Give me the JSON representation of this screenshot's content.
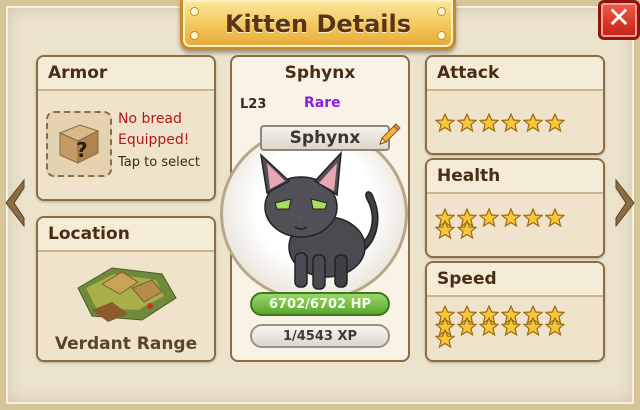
{
  "window": {
    "title": "Kitten Details",
    "close_label": "✕"
  },
  "armor": {
    "header": "Armor",
    "status_line1": "No bread",
    "status_line2": "Equipped!",
    "hint": "Tap to select",
    "slot_icon": "?"
  },
  "location": {
    "header": "Location",
    "name": "Verdant Range"
  },
  "kitten": {
    "name": "Sphynx",
    "level": "L23",
    "rarity": "Rare",
    "plate_name": "Sphynx",
    "hp": "6702/6702 HP",
    "xp": "1/4543 XP"
  },
  "stats": [
    {
      "header": "Attack",
      "stars": 6.0
    },
    {
      "header": "Health",
      "stars": 8.0
    },
    {
      "header": "Speed",
      "stars": 13.0
    }
  ],
  "colors": {
    "accent_gold": "#f3c75a",
    "close_red": "#c51f16",
    "rarity_purple": "#8b1fe0",
    "warning_red": "#b4161b",
    "hp_green": "#5aa52f"
  },
  "icons": {
    "close": "close-icon",
    "edit": "pencil-icon",
    "nav_left": "chevron-left-icon",
    "nav_right": "chevron-right-icon",
    "armor_empty": "bread-box-icon",
    "location": "map-terrain-icon",
    "star": "star-icon"
  }
}
